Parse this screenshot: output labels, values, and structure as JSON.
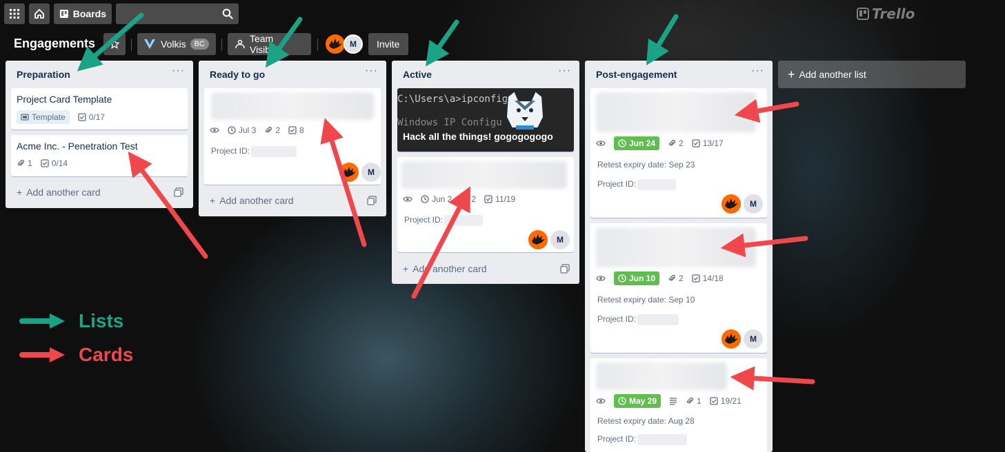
{
  "header": {
    "apps_icon": "apps-grid-icon",
    "home_icon": "home-icon",
    "boards_label": "Boards",
    "search_placeholder": "",
    "logo_text": "Trello"
  },
  "board": {
    "title": "Engagements",
    "workspace_label": "Volkis",
    "workspace_badge": "BC",
    "visibility_label": "Team Visible",
    "member_initial": "M",
    "invite_label": "Invite"
  },
  "lists": [
    {
      "title": "Preparation",
      "cards": [
        {
          "title": "Project Card Template",
          "label": "Template",
          "checklist": "0/17"
        },
        {
          "title": "Acme Inc. - Penetration Test",
          "attachments": "1",
          "checklist": "0/14"
        }
      ],
      "add_card": "Add another card"
    },
    {
      "title": "Ready to go",
      "cards": [
        {
          "due": "Jul 3",
          "attachments": "2",
          "checklist": "8",
          "project_id_label": "Project ID:",
          "member_initial": "M"
        }
      ],
      "add_card": "Add another card"
    },
    {
      "title": "Active",
      "cards": [
        {
          "cover_line1": "C:\\Users\\a>ipconfig",
          "cover_line2": "Windows IP Configu",
          "title": "Hack all the things! gogogogogo"
        },
        {
          "due": "Jun 2",
          "attachments": "2",
          "checklist": "11/19",
          "project_id_label": "Project ID:",
          "member_initial": "M"
        }
      ],
      "add_card": "Add another card"
    },
    {
      "title": "Post-engagement",
      "cards": [
        {
          "due": "Jun 24",
          "attachments": "2",
          "checklist": "13/17",
          "retest": "Retest expiry date: Sep 23",
          "project_id_label": "Project ID:",
          "member_initial": "M"
        },
        {
          "due": "Jun 10",
          "attachments": "2",
          "checklist": "14/18",
          "retest": "Retest expiry date: Sep 10",
          "project_id_label": "Project ID:",
          "member_initial": "M"
        },
        {
          "due": "May 29",
          "attachments": "1",
          "checklist": "19/21",
          "retest": "Retest expiry date: Aug 28",
          "project_id_label": "Project ID:"
        }
      ]
    }
  ],
  "add_list_label": "Add another list",
  "legend": {
    "lists_label": "Lists",
    "cards_label": "Cards",
    "lists_color": "#1aa385",
    "cards_color": "#f0474c"
  },
  "colors": {
    "due_complete": "#61bd4f",
    "list_bg": "#ebecf0"
  }
}
